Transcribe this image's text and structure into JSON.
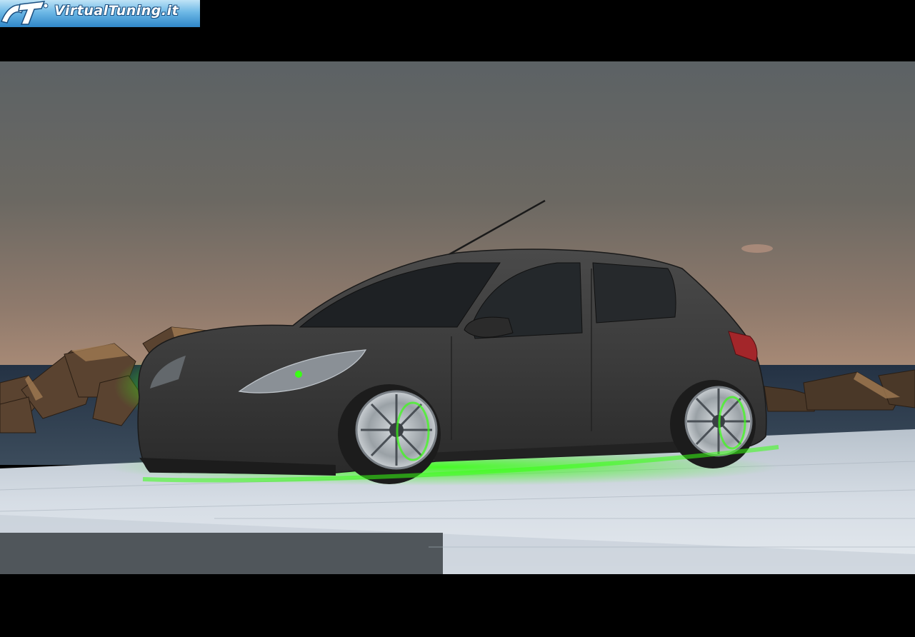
{
  "logo": {
    "text": "VirtualTuning.it",
    "icon": "vt-logo-icon",
    "colors": {
      "banner_top": "#bfe3f7",
      "banner_bottom": "#2f86c8",
      "text": "#ffffff"
    }
  },
  "scene": {
    "subject": "car",
    "colors": {
      "sky_top": "#5c6265",
      "sky_horizon": "#a88a76",
      "sea": "#2a3848",
      "car_body": "#3a3a3a",
      "underglow": "#39ff14",
      "pavement": "#c9d2dc",
      "rocks": "#6b4f36"
    }
  }
}
